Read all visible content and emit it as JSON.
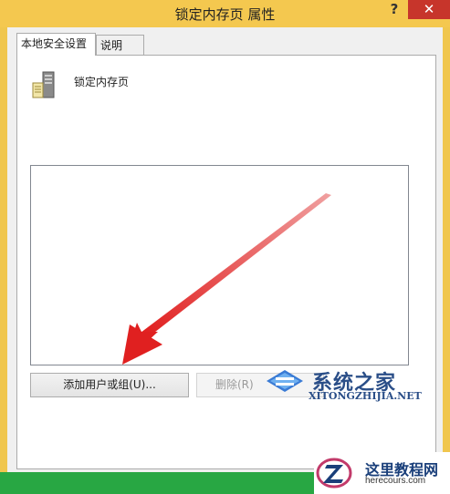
{
  "window": {
    "title": "锁定内存页 属性",
    "help_label": "?",
    "close_label": "✕"
  },
  "tabs": [
    {
      "label": "本地安全设置",
      "active": true
    },
    {
      "label": "说明",
      "active": false
    }
  ],
  "policy": {
    "name": "锁定内存页",
    "icon": "server-icon"
  },
  "user_list": {
    "items": []
  },
  "buttons": {
    "add_label": "添加用户或组(U)...",
    "remove_label": "删除(R)"
  },
  "annotation": {
    "arrow_color": "#e02424"
  },
  "watermarks": {
    "xitong_text": "系统之家",
    "xitong_url": "XITONGZHIJIA.NET",
    "herecours_text": "这里教程网",
    "herecours_url": "herecours.com"
  },
  "colors": {
    "titlebar": "#f4c84f",
    "close": "#c7352b",
    "green_bar": "#28a743"
  }
}
